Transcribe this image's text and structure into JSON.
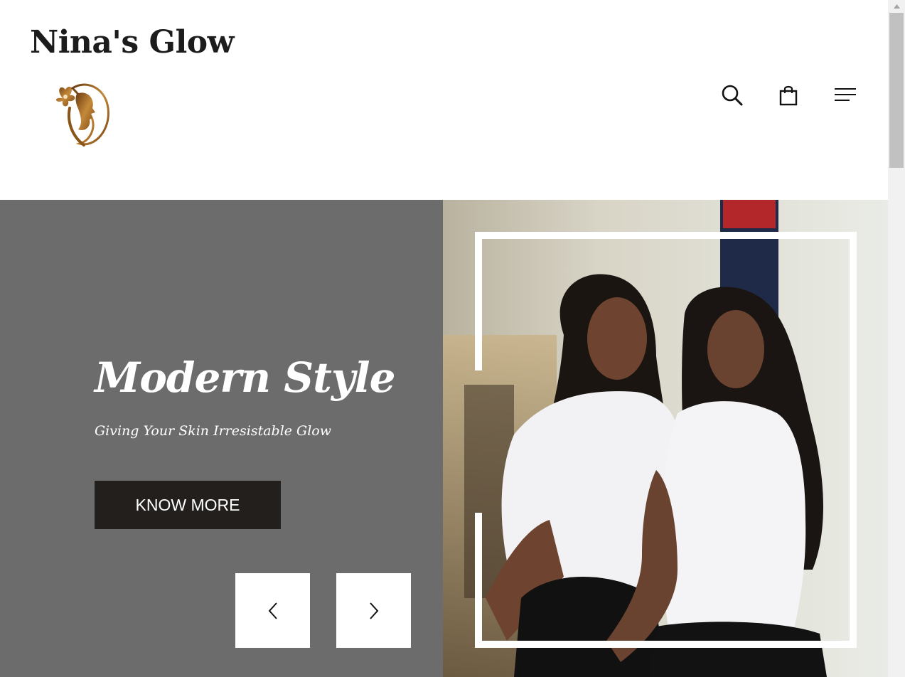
{
  "header": {
    "brand_title": "Nina's Glow",
    "logo": "woman-profile-flower-logo",
    "icons": {
      "search": "search-icon",
      "bag": "shopping-bag-icon",
      "menu": "hamburger-menu-icon"
    }
  },
  "hero": {
    "title": "Modern Style",
    "subtitle": "Giving Your Skin Irresistable Glow",
    "cta_label": "KNOW MORE",
    "prev_icon": "chevron-left-icon",
    "next_icon": "chevron-right-icon",
    "image": "two-women-in-white-tshirts-photo"
  },
  "colors": {
    "hero_panel": "#6c6c6c",
    "cta_background": "#221f1d",
    "logo_gold": "#a8701e",
    "text_dark": "#1c1c1c"
  }
}
